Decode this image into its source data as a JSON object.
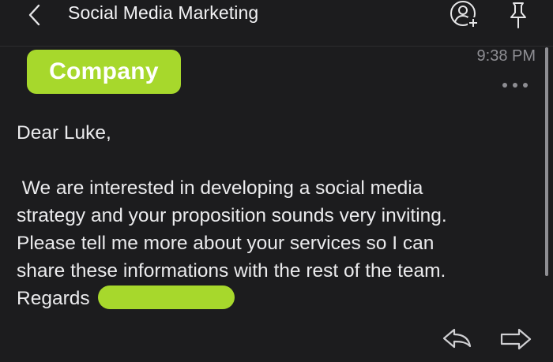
{
  "header": {
    "title": "Social Media Marketing",
    "back_icon": "chevron-left-icon",
    "add_contact_icon": "add-contact-icon",
    "pin_icon": "pin-icon"
  },
  "message": {
    "sender_label": "Company",
    "time": "9:38 PM",
    "greeting": "Dear Luke,",
    "body_lines": [
      " We are interested in developing a social media",
      "strategy and your proposition sounds very inviting.",
      "Please tell me more about your services so I can",
      "share these informations with the rest of the team."
    ],
    "signoff": "Regards"
  },
  "actions": {
    "more_icon": "more-horizontal-icon",
    "reply_icon": "reply-icon",
    "forward_icon": "forward-icon"
  },
  "colors": {
    "background": "#1c1c1e",
    "accent": "#a7d82c",
    "text": "#ebebed",
    "muted": "#8e8e93"
  }
}
